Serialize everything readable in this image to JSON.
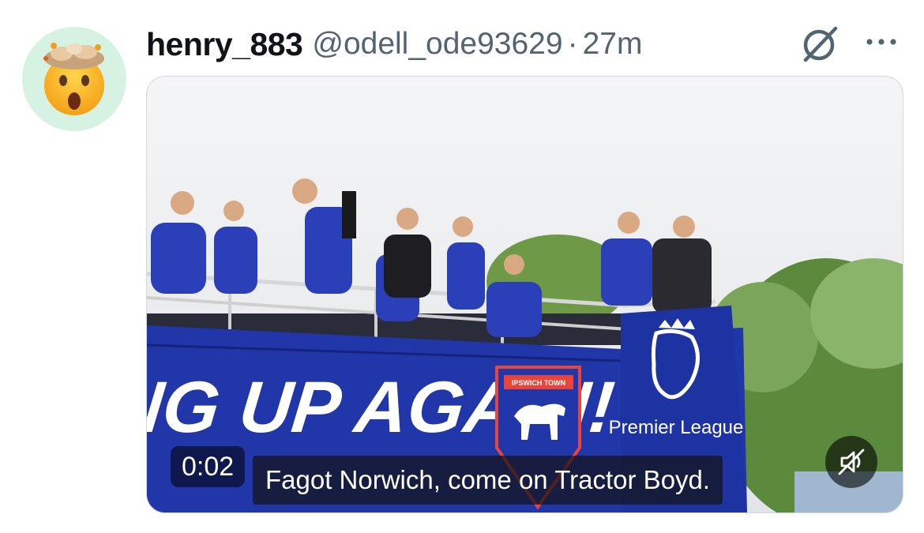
{
  "tweet": {
    "display_name": "henry_883",
    "handle": "@odell_ode93629",
    "separator": "·",
    "time": "27m",
    "avatar_icon": "exploding-head-emoji-icon"
  },
  "media": {
    "type": "video",
    "timestamp": "0:02",
    "caption": "Fagot Norwich, come on Tractor Boyd.",
    "bus_banner_text": "NG UP AGAIN!",
    "crest_text": "IPSWICH TOWN",
    "sponsor_text": "Premier League",
    "mute_icon": "speaker-muted-icon"
  },
  "actions": {
    "grok_icon": "grok-icon",
    "more_icon": "more-dots-icon"
  },
  "colors": {
    "name": "#0f1419",
    "secondary": "#536471",
    "avatar_bg": "#d6f2e3",
    "bus_blue": "#2136a8"
  }
}
